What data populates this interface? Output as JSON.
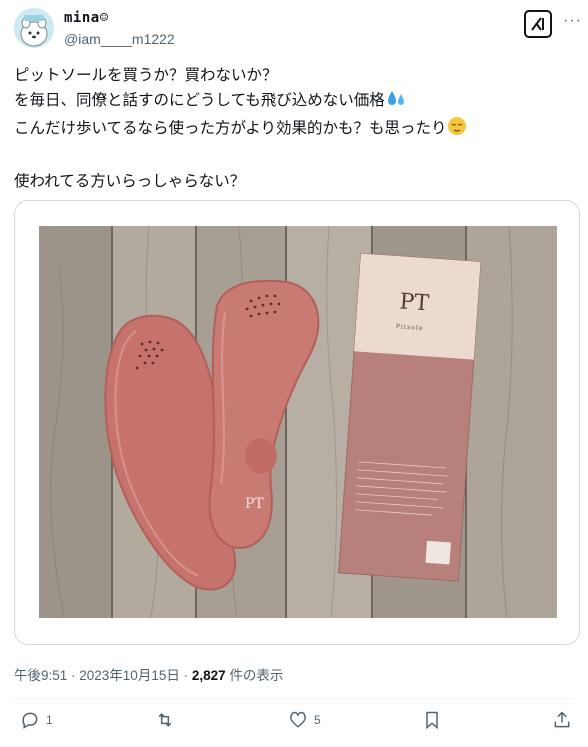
{
  "author": {
    "name": "mina☺",
    "handle": "@iam____m1222"
  },
  "tweet": {
    "lines": [
      "ピットソールを買うか？買わないか？",
      "を毎日、同僚と話すのにどうしても飛び込めない価格",
      "こんだけ歩いてるなら使った方がより効果的かも？も思ったり",
      "",
      "使われてる方いらっしゃらない？"
    ],
    "emoji_line2": "sweat-droplets",
    "emoji_line3": "relieved-face"
  },
  "media": {
    "box_logo": "PT",
    "box_brand": "Pitsole",
    "insole_logo": "PT"
  },
  "meta": {
    "time": "午後9:51 · 2023年10月15日 · ",
    "views_count": "2,827",
    "views_label": " 件の表示"
  },
  "actions": {
    "reply_count": "1",
    "retweet_count": "",
    "like_count": "5"
  },
  "colors": {
    "text": "#0f1419",
    "secondary": "#536471",
    "border": "#cfd9de",
    "insole": "#c7736d",
    "box": "#b8807a",
    "box_top": "#ecd9d0"
  }
}
